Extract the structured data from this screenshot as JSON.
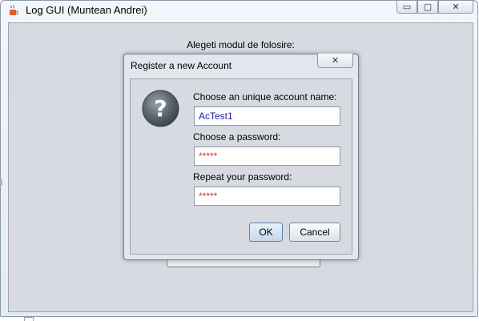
{
  "window": {
    "title": "Log GUI (Muntean Andrei)",
    "controls": {
      "minimize": "▭",
      "maximize": "▢",
      "close": "✕"
    }
  },
  "main": {
    "prompt": "Alegeti modul de folosire:"
  },
  "dialog": {
    "title": "Register a new Account",
    "close": "✕",
    "icon": "question-icon",
    "account_label": "Choose an unique account name:",
    "account_value": "AcTest1",
    "password_label": "Choose a password:",
    "password_value": "*****",
    "repeat_label": "Repeat your password:",
    "repeat_value": "*****",
    "ok_label": "OK",
    "cancel_label": "Cancel"
  },
  "colors": {
    "content_bg": "#d8dae2",
    "account_text": "#1a1a9a",
    "password_text": "#c0392b"
  }
}
